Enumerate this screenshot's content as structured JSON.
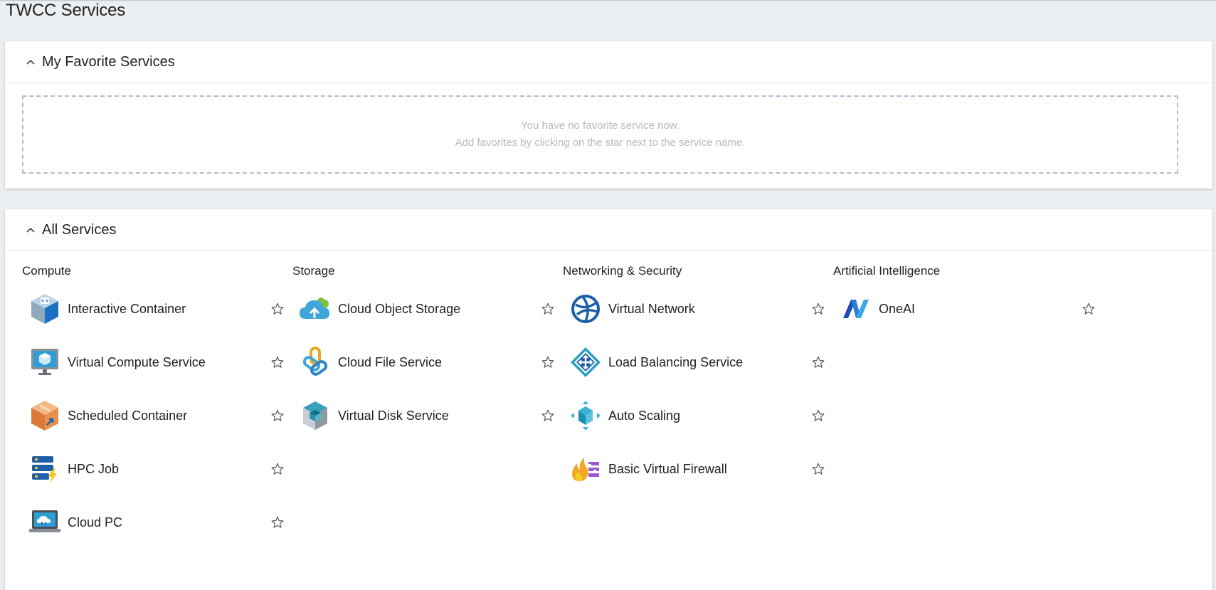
{
  "page": {
    "title": "TWCC Services"
  },
  "favorites": {
    "title": "My Favorite Services",
    "empty_line1": "You have no favorite service now.",
    "empty_line2": "Add favorites by clicking on the star next to the service name."
  },
  "all_services": {
    "title": "All Services",
    "categories": [
      {
        "title": "Compute",
        "services": [
          {
            "name": "Interactive Container",
            "icon": "interactive-container-icon"
          },
          {
            "name": "Virtual Compute Service",
            "icon": "virtual-compute-icon"
          },
          {
            "name": "Scheduled Container",
            "icon": "scheduled-container-icon"
          },
          {
            "name": "HPC Job",
            "icon": "hpc-job-icon"
          },
          {
            "name": "Cloud PC",
            "icon": "cloud-pc-icon"
          }
        ]
      },
      {
        "title": "Storage",
        "services": [
          {
            "name": "Cloud Object Storage",
            "icon": "cloud-object-storage-icon"
          },
          {
            "name": "Cloud File Service",
            "icon": "cloud-file-service-icon"
          },
          {
            "name": "Virtual Disk Service",
            "icon": "virtual-disk-icon"
          }
        ]
      },
      {
        "title": "Networking & Security",
        "services": [
          {
            "name": "Virtual Network",
            "icon": "virtual-network-icon"
          },
          {
            "name": "Load Balancing Service",
            "icon": "load-balancing-icon"
          },
          {
            "name": "Auto Scaling",
            "icon": "auto-scaling-icon"
          },
          {
            "name": "Basic Virtual Firewall",
            "icon": "firewall-icon"
          }
        ]
      },
      {
        "title": "Artificial Intelligence",
        "services": [
          {
            "name": "OneAI",
            "icon": "oneai-icon"
          }
        ]
      }
    ]
  }
}
